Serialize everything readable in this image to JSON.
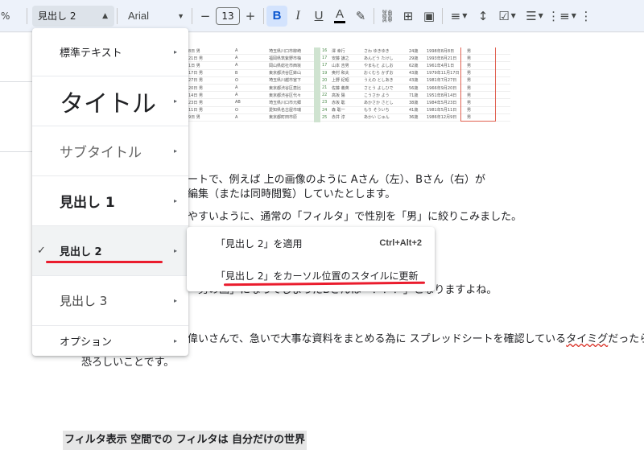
{
  "toolbar": {
    "zoom": "%",
    "style_value": "見出し 2",
    "font_value": "Arial",
    "minus": "−",
    "font_size": "13",
    "plus": "+",
    "bold": "B",
    "italic": "I",
    "underline": "U",
    "text_color": "A",
    "highlight_icon": "✎",
    "link_icon": "⛓",
    "comment_icon": "⊞",
    "image_icon": "▣",
    "align_icon": "≡",
    "line_spacing_icon": "↕",
    "checklist_icon": "☑",
    "bullets_icon": "☰",
    "numbered_icon": "⋮≡",
    "more_icon": "⋮"
  },
  "style_menu": {
    "items": [
      {
        "label": "標準テキスト"
      },
      {
        "label": "タイトル"
      },
      {
        "label": "サブタイトル"
      },
      {
        "label": "見出し 1"
      },
      {
        "label": "見出し 2"
      },
      {
        "label": "見出し 3"
      },
      {
        "label": "オプション"
      }
    ],
    "arrow": "▸",
    "check": "✓"
  },
  "sub_menu": {
    "apply_label": "「見出し 2」を適用",
    "apply_shortcut": "Ctrl+Alt+2",
    "update_label": "「見出し 2」をカーソル位置のスタイルに更新"
  },
  "doc": {
    "line1": "ートで、例えば 上の画像のように Aさん（左）、Bさん（右）が",
    "line2": "編集（または同時閲覧）していたとします。",
    "line3": "やすいように、通常の「フィルタ」で性別を「男」に絞りこみました。",
    "line4": "「男の画」になってしまったBさんは「？？？」となりますよね。",
    "line5a": "偉いさんで、急いで大事な資料をまとめる為に スプレッドシートを確認している",
    "line5b": "タイミグ",
    "line5c": "だったら・",
    "line6": "恐ろしいことです。",
    "heading": "フィルタ表示 空間での フィルタは 自分だけの世界"
  },
  "sheet": {
    "rows": [
      [
        "8日 男",
        "A",
        "埼玉県川口市柳崎",
        "16",
        "澤 幸行",
        "さわ ゆきゆき",
        "24歳",
        "1998年8月8日",
        "男"
      ],
      [
        "21日 男",
        "A",
        "福岡県筑紫野市柚",
        "17",
        "安藤 謙之",
        "あんどう たけし",
        "29歳",
        "1993年8月21日",
        "男"
      ],
      [
        "1日 男",
        "A",
        "岡山県総社市西坂",
        "17",
        "山本 吉男",
        "やまもと よしお",
        "62歳",
        "1961年4月1日",
        "男"
      ],
      [
        "17日 男",
        "B",
        "東京都渋谷区鉢山",
        "19",
        "奥村 和夫",
        "おくむら かずお",
        "43歳",
        "1979年11月17日",
        "男"
      ],
      [
        "27日 男",
        "O",
        "埼玉県川越市宮下",
        "20",
        "上野 紀昭",
        "うえの としあき",
        "43歳",
        "1981年7月27日",
        "男"
      ],
      [
        "20日 男",
        "A",
        "東京都渋谷区恵比",
        "21",
        "佐藤 義英",
        "さとう よしひで",
        "56歳",
        "1966年9月20日",
        "男"
      ],
      [
        "14日 男",
        "A",
        "東京都渋谷区代々",
        "22",
        "高坂 陽",
        "こうさか よう",
        "71歳",
        "1951年8月14日",
        "男"
      ],
      [
        "23日 男",
        "AB",
        "埼玉県川口市元郷",
        "23",
        "赤坂 聡",
        "あかさか さとし",
        "38歳",
        "1984年5月23日",
        "男"
      ],
      [
        "11日 男",
        "O",
        "愛知県名古屋市瑞",
        "24",
        "森 聡一",
        "もり そういち",
        "41歳",
        "1981年5月11日",
        "男"
      ],
      [
        "9日 男",
        "A",
        "東京都町田市原",
        "25",
        "赤井 淳",
        "あかい じゅん",
        "36歳",
        "1986年12月9日",
        "男"
      ]
    ]
  }
}
